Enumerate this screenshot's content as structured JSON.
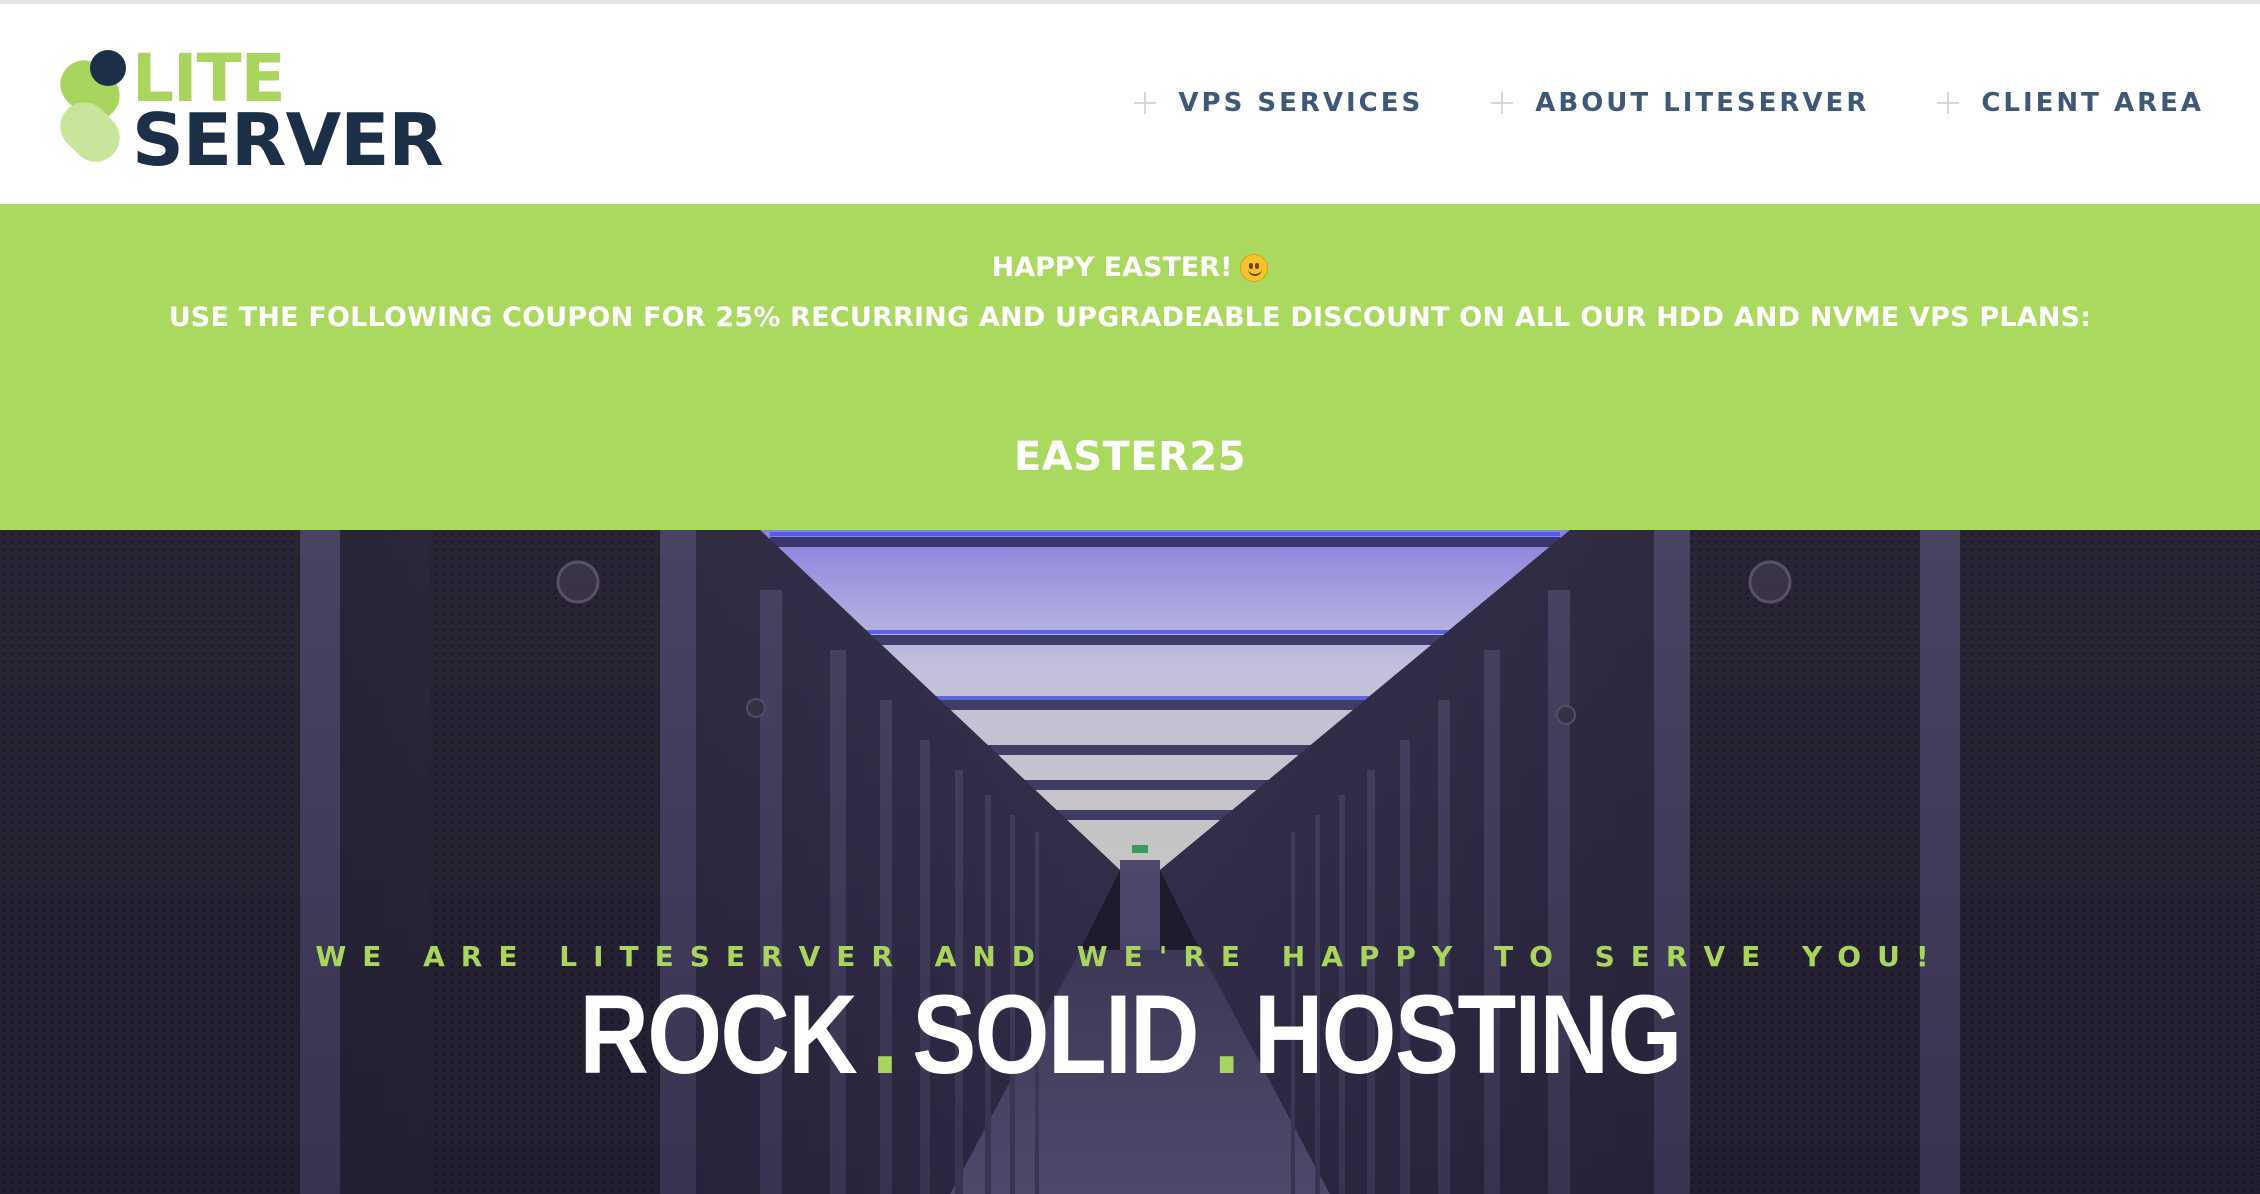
{
  "header": {
    "logo": {
      "line1": "LITE",
      "line2": "SERVER"
    },
    "nav": [
      {
        "label": "VPS SERVICES"
      },
      {
        "label": "ABOUT LITESERVER"
      },
      {
        "label": "CLIENT AREA"
      }
    ]
  },
  "promo": {
    "title": "HAPPY EASTER!",
    "text": "USE THE FOLLOWING COUPON FOR 25% RECURRING AND UPGRADEABLE DISCOUNT ON ALL OUR HDD AND NVME VPS PLANS:",
    "code": "EASTER25"
  },
  "hero": {
    "tagline": "WE ARE LITESERVER AND WE'RE HAPPY TO SERVE YOU!",
    "headline": {
      "word1": "ROCK",
      "word2": "SOLID",
      "word3": "HOSTING",
      "separator": "."
    }
  },
  "colors": {
    "accent_green": "#abd95f",
    "navy": "#1d2f47",
    "nav_text": "#3e5877"
  },
  "icons": [
    "plus-icon",
    "smiley-icon",
    "logo-mark-icon"
  ]
}
